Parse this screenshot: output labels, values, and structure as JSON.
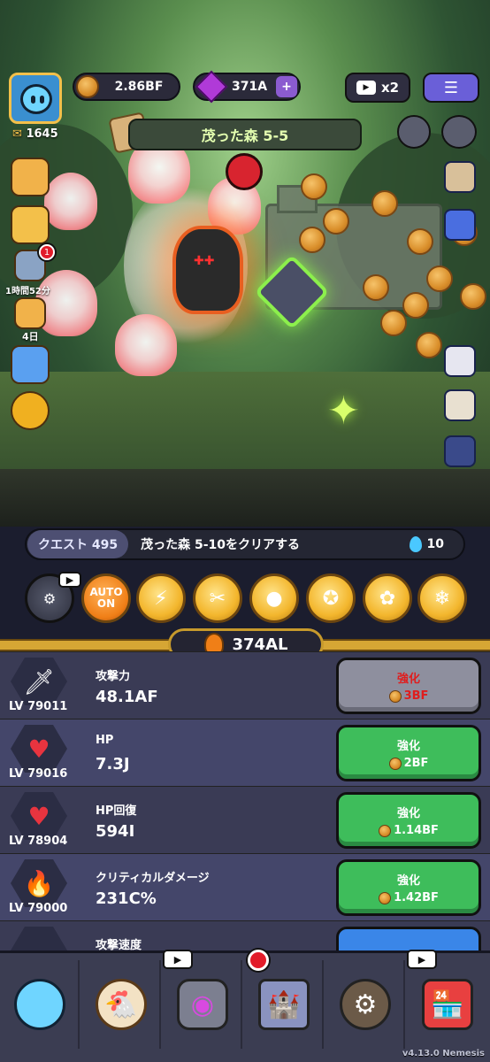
{
  "hud": {
    "coins": "2.86BF",
    "gems": "371A",
    "speed": "x2",
    "player_power": "1645",
    "stage": "茂った森 5-5",
    "event_timer": "1時間52分",
    "event_days": "4日",
    "notification_count": "1"
  },
  "quest": {
    "tag": "クエスト 495",
    "text": "茂った森 5-10をクリアする",
    "reward": "10"
  },
  "skills": {
    "auto": "AUTO\nON",
    "icons": [
      "lightning-icon",
      "bomb-icon",
      "claw-icon",
      "coin-icon",
      "bomb-hat-icon",
      "leaf-icon",
      "snowflake-icon"
    ]
  },
  "wallet": {
    "amount": "374AL"
  },
  "upgrades": [
    {
      "level": "LV 79011",
      "name": "攻撃力",
      "value": "48.1AF",
      "button": "強化",
      "cost": "3BF",
      "affordable": false
    },
    {
      "level": "LV 79016",
      "name": "HP",
      "value": "7.3J",
      "button": "強化",
      "cost": "2BF",
      "affordable": true
    },
    {
      "level": "LV 78904",
      "name": "HP回復",
      "value": "594I",
      "button": "強化",
      "cost": "1.14BF",
      "affordable": true
    },
    {
      "level": "LV 79000",
      "name": "クリティカルダメージ",
      "value": "231C%",
      "button": "強化",
      "cost": "1.42BF",
      "affordable": true
    },
    {
      "level": "",
      "name": "攻撃速度",
      "value": "",
      "button": "",
      "cost": "",
      "affordable": true
    }
  ],
  "nav": {
    "tabs": [
      "character-tab",
      "chicken-tab",
      "portal-tab",
      "castle-tab",
      "forge-tab",
      "shop-tab"
    ]
  },
  "footer": {
    "version": "v4.13.0 Nemesis"
  },
  "colors": {
    "green_button": "#3ebd5b",
    "gray_button": "#8e8f9e",
    "gold_accent": "#d6a634",
    "panel_bg": "#3a3b55"
  }
}
